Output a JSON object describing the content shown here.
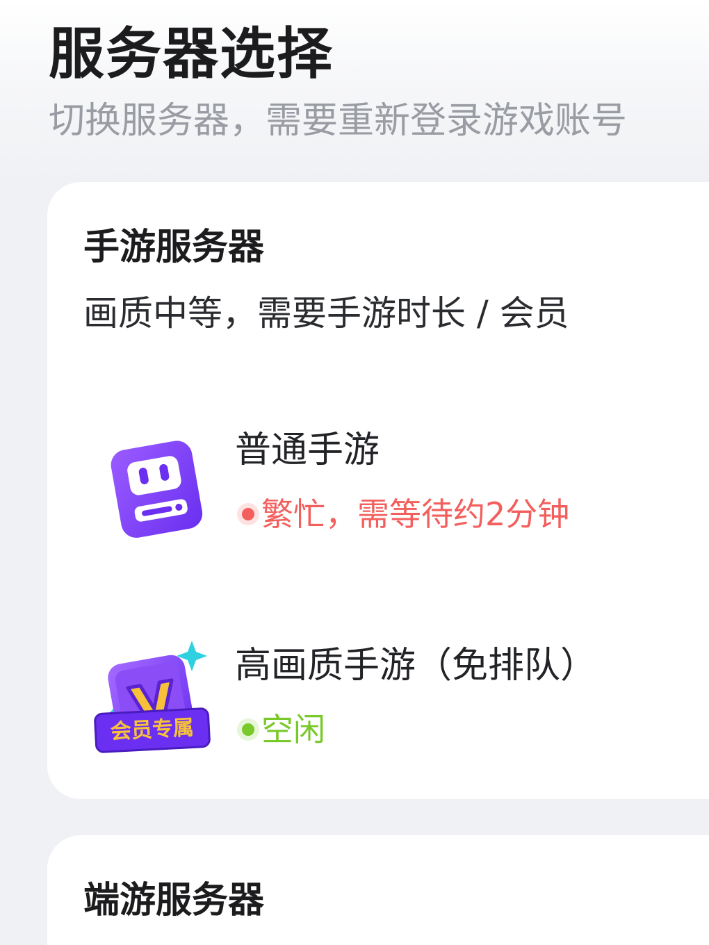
{
  "header": {
    "title": "服务器选择",
    "subtitle": "切换服务器，需要重新登录游戏账号"
  },
  "mobile_section": {
    "title": "手游服务器",
    "description": "画质中等，需要手游时长 / 会员",
    "servers": [
      {
        "name": "普通手游",
        "icon": "robot-console-icon",
        "status": "繁忙，需等待约2分钟",
        "status_color": "#f25f5c"
      },
      {
        "name": "高画质手游（免排队）",
        "icon": "vip-v-icon",
        "badge": "会员专属",
        "status": "空闲",
        "status_color": "#7ac92a"
      }
    ]
  },
  "pc_section": {
    "title": "端游服务器"
  },
  "colors": {
    "accent_purple": "#7b3ff2",
    "busy": "#f25f5c",
    "idle": "#7ac92a",
    "vip_gold": "#f7c23a"
  }
}
